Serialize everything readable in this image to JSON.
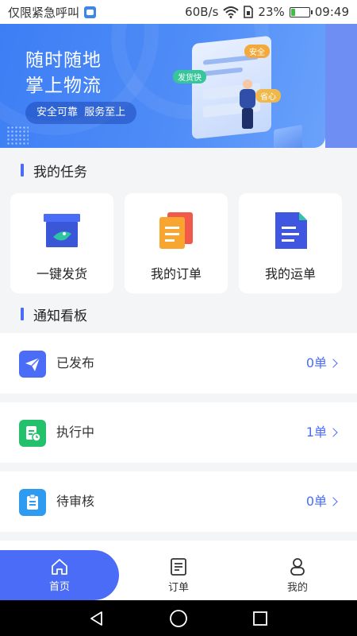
{
  "status_bar": {
    "left_text": "仅限紧急呼叫",
    "network_speed": "60B/s",
    "battery_percent": "23%",
    "battery_level": 0.23,
    "time": "09:49"
  },
  "banner": {
    "title_line1": "随时随地",
    "title_line2": "掌上物流",
    "slogan": "安全可靠  服务至上",
    "illus_tag1": "发货快",
    "illus_tag2": "安全",
    "illus_tag3": "省心"
  },
  "tasks": {
    "section_title": "我的任务",
    "items": [
      {
        "label": "一键发货",
        "icon": "shipping-box-icon"
      },
      {
        "label": "我的订单",
        "icon": "order-documents-icon"
      },
      {
        "label": "我的运单",
        "icon": "waybill-document-icon"
      }
    ]
  },
  "notices": {
    "section_title": "通知看板",
    "items": [
      {
        "label": "已发布",
        "count": "0单",
        "icon": "paper-plane-icon",
        "color": "#4a6cf7"
      },
      {
        "label": "执行中",
        "count": "1单",
        "icon": "document-in-progress-icon",
        "color": "#23c16b"
      },
      {
        "label": "待审核",
        "count": "0单",
        "icon": "clipboard-icon",
        "color": "#2f9bf0"
      }
    ]
  },
  "tab_bar": {
    "tabs": [
      {
        "label": "首页",
        "icon": "home-icon",
        "active": true
      },
      {
        "label": "订单",
        "icon": "order-list-icon",
        "active": false
      },
      {
        "label": "我的",
        "icon": "profile-icon",
        "active": false
      }
    ]
  },
  "colors": {
    "accent": "#4a6cf7",
    "banner": "#3d7ef5",
    "background": "#f4f5f7"
  }
}
